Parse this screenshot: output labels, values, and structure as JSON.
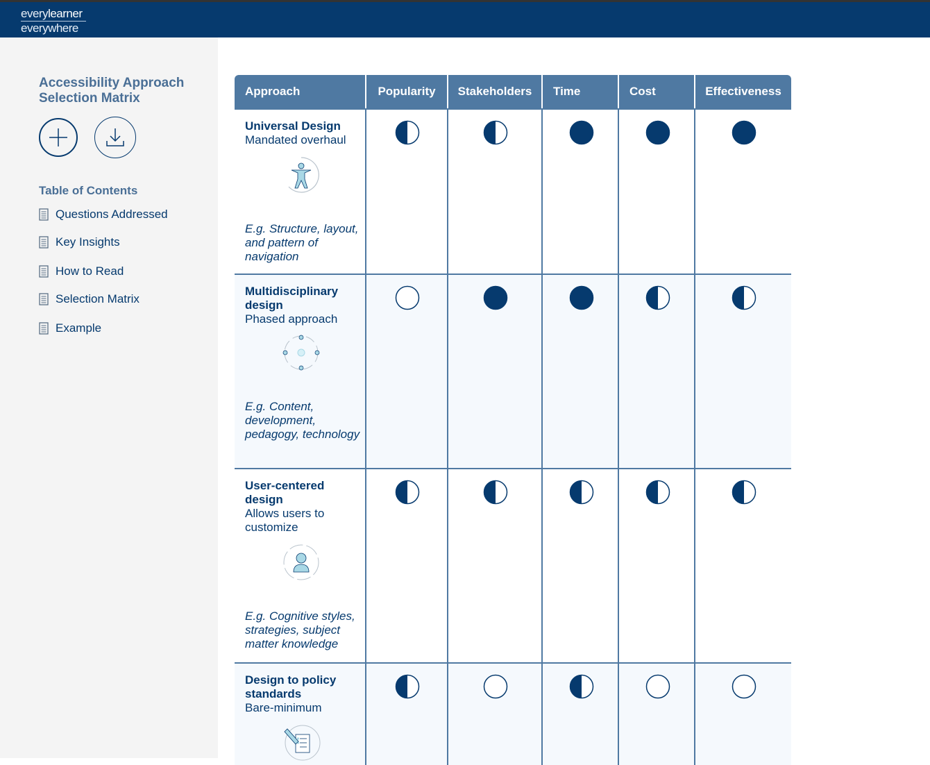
{
  "brand": {
    "line1_a": "every",
    "line1_b": "learner",
    "line2": "everywhere"
  },
  "sidebar": {
    "title": "Accessibility Approach Selection Matrix",
    "add_icon": "plus-icon",
    "download_icon": "download-icon",
    "toc_title": "Table of Contents",
    "toc": [
      {
        "label": "Questions Addressed",
        "icon": "document-icon"
      },
      {
        "label": "Key Insights",
        "icon": "document-icon"
      },
      {
        "label": "How to Read",
        "icon": "document-icon"
      },
      {
        "label": "Selection Matrix",
        "icon": "document-icon"
      },
      {
        "label": "Example",
        "icon": "document-icon"
      }
    ]
  },
  "matrix": {
    "headers": [
      "Approach",
      "Popularity",
      "Stakeholders",
      "Time",
      "Cost",
      "Effectiveness"
    ],
    "legend_levels": {
      "full": "filled circle",
      "half": "half-filled circle",
      "none": "empty circle"
    },
    "rows": [
      {
        "name": "Universal Design",
        "subtitle": "Mandated overhaul",
        "icon": "accessibility-person-icon",
        "example": "E.g. Structure, layout, and pattern of navigation",
        "ratings": [
          "half",
          "half",
          "full",
          "full",
          "full"
        ]
      },
      {
        "name": "Multidisciplinary design",
        "subtitle": "Phased approach",
        "icon": "team-idea-icon",
        "example": "E.g. Content, development, pedagogy, technology",
        "ratings": [
          "none",
          "full",
          "full",
          "half",
          "half"
        ]
      },
      {
        "name": "User-centered design",
        "subtitle": "Allows users to customize",
        "icon": "user-cycle-icon",
        "example": "E.g. Cognitive styles, strategies, subject matter knowledge",
        "ratings": [
          "half",
          "half",
          "half",
          "half",
          "half"
        ]
      },
      {
        "name": "Design to policy standards",
        "subtitle": "Bare-minimum",
        "icon": "checklist-pencil-icon",
        "example": "",
        "ratings": [
          "half",
          "none",
          "half",
          "none",
          "none"
        ]
      }
    ]
  },
  "colors": {
    "navy": "#063a6e",
    "header_blue": "#4f79a2",
    "accent_light": "#a9d8e6"
  }
}
